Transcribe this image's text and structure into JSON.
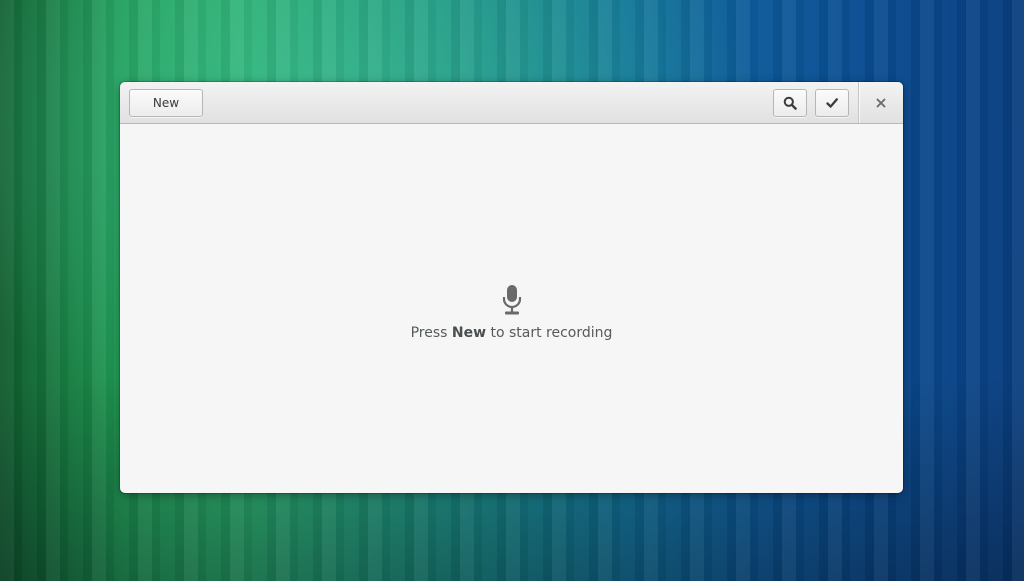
{
  "window": {
    "header": {
      "new_button_label": "New",
      "search_icon": "search-icon",
      "select_icon": "checkmark-icon",
      "close_icon": "close-icon"
    },
    "empty_state": {
      "icon": "microphone-icon",
      "text_before": "Press ",
      "text_bold": "New",
      "text_after": " to start recording"
    }
  },
  "colors": {
    "window_bg": "#f6f6f6",
    "header_bg": "#e8e8e8",
    "text": "#555a5c"
  }
}
